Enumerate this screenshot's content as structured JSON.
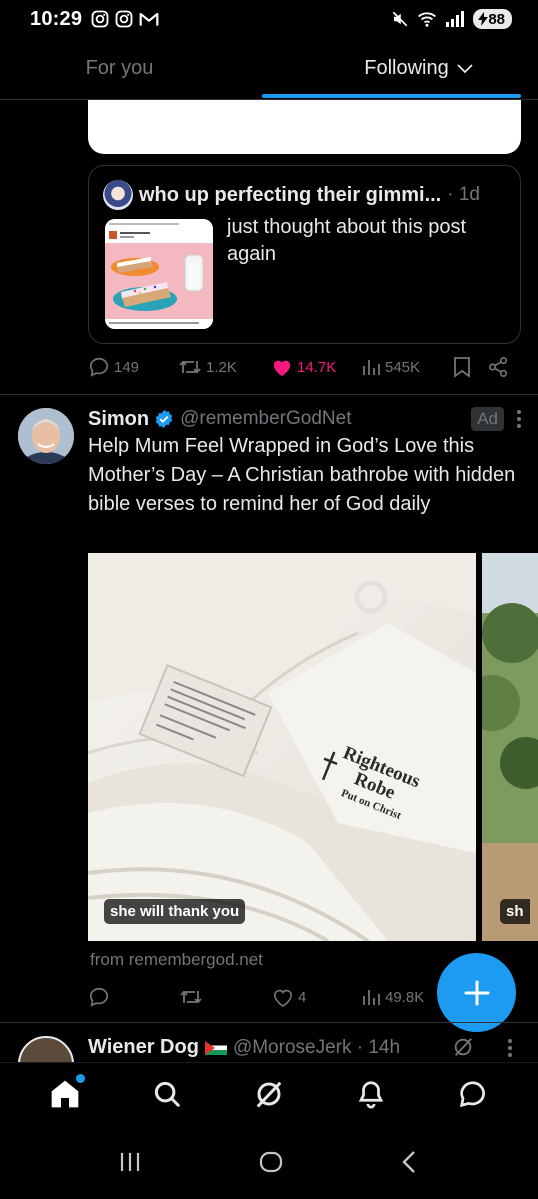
{
  "status_bar": {
    "time": "10:29",
    "battery": "88",
    "left_icons": [
      "instagram-icon",
      "instagram-icon",
      "gmail-icon"
    ],
    "right_icons": [
      "mute-icon",
      "wifi-icon",
      "signal-icon"
    ]
  },
  "top_tabs": {
    "for_you": "For you",
    "following": "Following"
  },
  "prev_tweet": {
    "quote": {
      "name": "who up perfecting their gimmi...",
      "time": "· 1d",
      "text": "just thought about this post again"
    },
    "actions": {
      "replies": "149",
      "reposts": "1.2K",
      "likes": "14.7K",
      "views": "545K"
    },
    "accent_like_color": "#f91880"
  },
  "ad_tweet": {
    "name": "Simon",
    "handle": "@rememberGodNet",
    "badge": "Ad",
    "text": "Help Mum Feel Wrapped in God’s Love this Mother’s Day – A Christian bathrobe with hidden bible verses to remind her of God daily",
    "media": {
      "label_1": "she will thank you",
      "label_2": "sh",
      "embroidery_line1": "Righteous",
      "embroidery_line2": "Robe",
      "embroidery_line3": "Put on Christ"
    },
    "source": "from remembergod.net",
    "actions": {
      "replies": "",
      "reposts": "",
      "likes": "4",
      "views": "49.8K"
    }
  },
  "next_tweet": {
    "name": "Wiener Dog",
    "handle": "@MoroseJerk · 14h"
  },
  "colors": {
    "accent": "#1d9bf0",
    "background": "#000000",
    "muted": "#71767b",
    "verified": "#1d9bf0"
  }
}
